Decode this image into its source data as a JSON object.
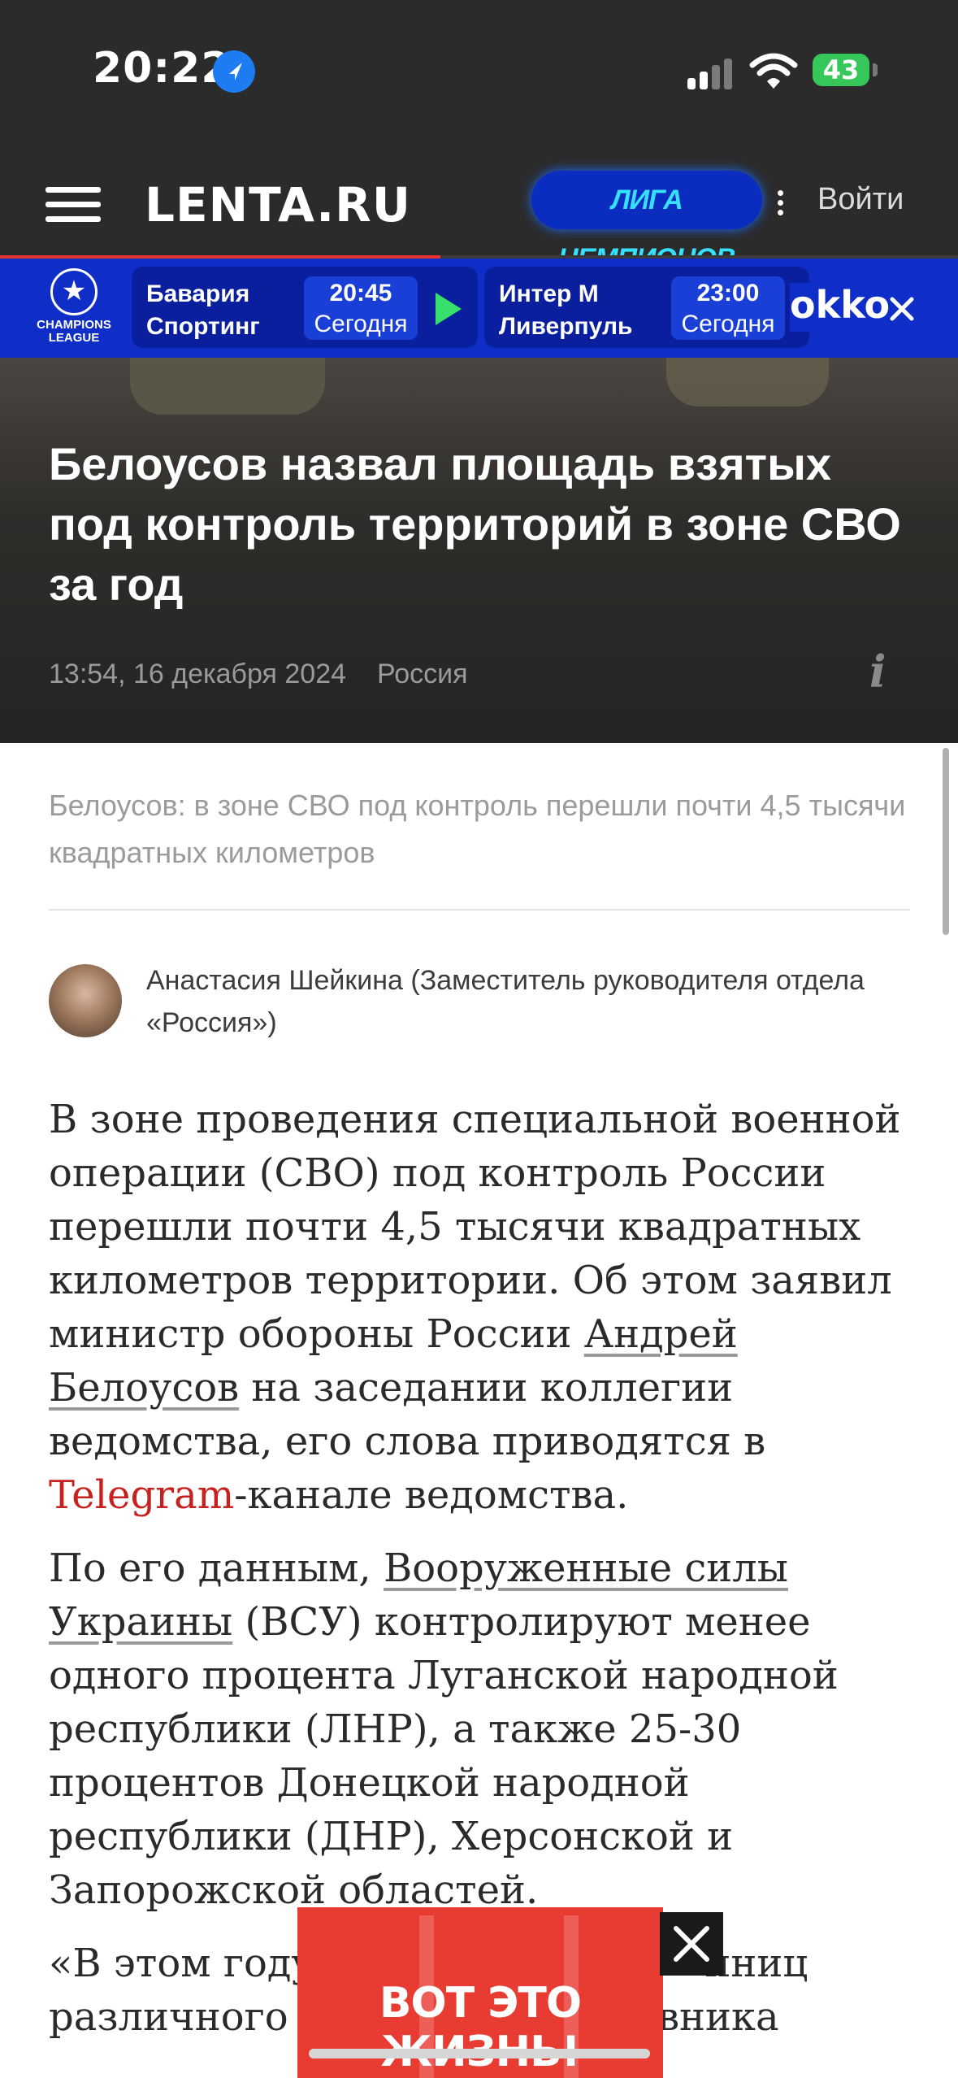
{
  "status_bar": {
    "time": "20:22",
    "battery": "43"
  },
  "header": {
    "logo": "LENTA.RU",
    "promo_label": "ЛИГА ЧЕМПИОНОВ",
    "login_label": "Войти"
  },
  "reading_progress": 0.46,
  "scorebar": {
    "league_logo_text": "CHAMPIONS LEAGUE",
    "matches": [
      {
        "team_home": "Бавария",
        "team_away": "Спортинг",
        "time": "20:45",
        "day": "Сегодня"
      },
      {
        "team_home": "Интер М",
        "team_away": "Ливерпуль",
        "time": "23:00",
        "day": "Сегодня"
      }
    ],
    "partner": "okko"
  },
  "article": {
    "headline": "Белоусов назвал площадь взятых под контроль территорий в зоне СВО за год",
    "datetime": "13:54, 16 декабря 2024",
    "rubric": "Россия",
    "lead": "Белоусов: в зоне СВО под контроль перешли почти 4,5 тысячи квадратных километров",
    "author": "Анастасия Шейкина (Заместитель руководителя отдела «Россия»)",
    "p1": {
      "a": "В зоне проведения специальной военной операции (СВО) под контроль России перешли почти 4,5 тысячи квадратных километров территории. Об этом заявил министр обороны России ",
      "link_person": "Андрей Белоусов",
      "b": " на заседании коллегии ведомства, его слова приводятся в ",
      "link_telegram": "Telegram",
      "c": "-канале ведомства."
    },
    "p2": {
      "a": "По его данным, ",
      "link_afu": "Вооруженные силы Украины",
      "b": " (ВСУ) контролируют менее одного процента Луганской народной республики (ЛНР), а также 25-30 процентов Донецкой народной республики (ДНР), Херсонской и Запорожской областей."
    },
    "p3_visible": "«В этом году уничтожено          иниц различного в          ики противника"
  },
  "ad": {
    "text": "ВОТ ЭТО ЖИЗНЬ!"
  },
  "colors": {
    "accent_red": "#c8201e",
    "scorebar_blue": "#0f2ec8",
    "dark_bg": "#2b2b2b"
  }
}
